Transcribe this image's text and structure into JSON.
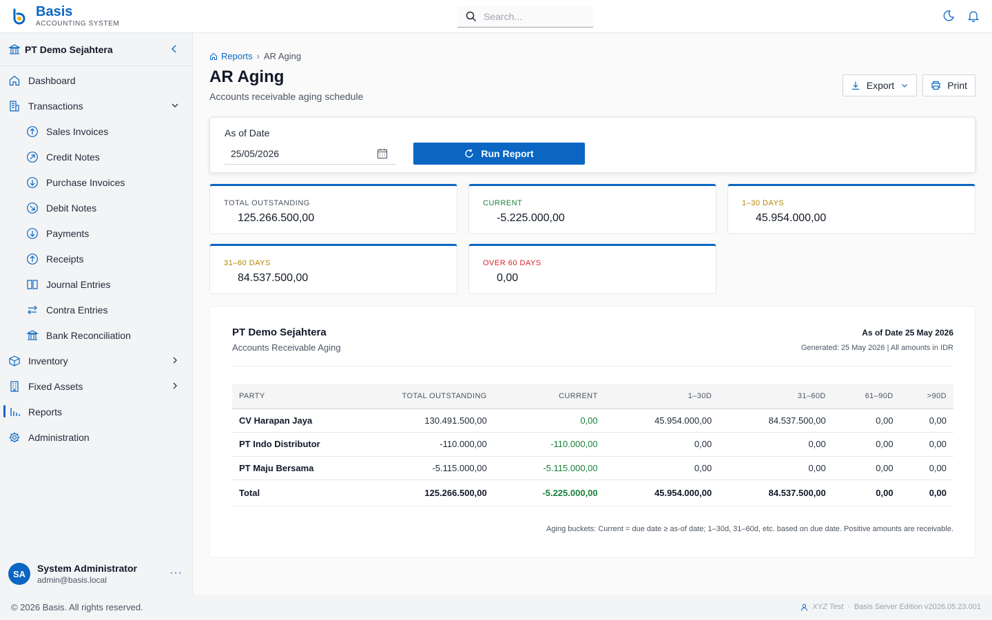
{
  "app": {
    "name": "Basis",
    "subtitle": "ACCOUNTING SYSTEM"
  },
  "search": {
    "placeholder": "Search..."
  },
  "org": {
    "name": "PT Demo Sejahtera"
  },
  "nav": {
    "dashboard": "Dashboard",
    "transactions": "Transactions",
    "sales_invoices": "Sales Invoices",
    "credit_notes": "Credit Notes",
    "purchase_invoices": "Purchase Invoices",
    "debit_notes": "Debit Notes",
    "payments": "Payments",
    "receipts": "Receipts",
    "journal_entries": "Journal Entries",
    "contra_entries": "Contra Entries",
    "bank_reconciliation": "Bank Reconciliation",
    "inventory": "Inventory",
    "fixed_assets": "Fixed Assets",
    "reports": "Reports",
    "administration": "Administration"
  },
  "user": {
    "initials": "SA",
    "name": "System Administrator",
    "email": "admin@basis.local",
    "more": "···"
  },
  "footer": {
    "copyright": "© 2026 Basis. All rights reserved.",
    "tenant": "XYZ Test",
    "dot": "·",
    "version": "Basis Server Edition v2026.05.23.001"
  },
  "breadcrumb": {
    "parent": "Reports",
    "sep": "›",
    "current": "AR Aging"
  },
  "page": {
    "title": "AR Aging",
    "subtitle": "Accounts receivable aging schedule"
  },
  "actions": {
    "export": "Export",
    "print": "Print"
  },
  "filter": {
    "label": "As of Date",
    "date": "25/05/2026",
    "run": "Run Report"
  },
  "stats": [
    {
      "label": "TOTAL OUTSTANDING",
      "value": "125.266.500,00",
      "color": "#4b5563"
    },
    {
      "label": "CURRENT",
      "value": "-5.225.000,00",
      "color": "#198038"
    },
    {
      "label": "1–30 DAYS",
      "value": "45.954.000,00",
      "color": "#b28600"
    },
    {
      "label": "31–60 DAYS",
      "value": "84.537.500,00",
      "color": "#b28600"
    },
    {
      "label": "OVER 60 DAYS",
      "value": "0,00",
      "color": "#da1e28"
    }
  ],
  "report": {
    "company": "PT Demo Sejahtera",
    "title": "Accounts Receivable Aging",
    "as_of": "As of Date 25 May 2026",
    "generated": "Generated: 25 May 2026 | All amounts in IDR",
    "columns": [
      "PARTY",
      "TOTAL OUTSTANDING",
      "CURRENT",
      "1–30D",
      "31–60D",
      "61–90D",
      ">90D"
    ],
    "rows": [
      [
        "CV Harapan Jaya",
        "130.491.500,00",
        "0,00",
        "45.954.000,00",
        "84.537.500,00",
        "0,00",
        "0,00"
      ],
      [
        "PT Indo Distributor",
        "-110.000,00",
        "-110.000,00",
        "0,00",
        "0,00",
        "0,00",
        "0,00"
      ],
      [
        "PT Maju Bersama",
        "-5.115.000,00",
        "-5.115.000,00",
        "0,00",
        "0,00",
        "0,00",
        "0,00"
      ]
    ],
    "total": [
      "Total",
      "125.266.500,00",
      "-5.225.000,00",
      "45.954.000,00",
      "84.537.500,00",
      "0,00",
      "0,00"
    ],
    "note": "Aging buckets: Current = due date ≥ as-of date; 1–30d, 31–60d, etc. based on due date. Positive amounts are receivable."
  },
  "colors": {
    "accent": "#0a66c2",
    "positive": "#198038",
    "warning": "#b28600",
    "danger": "#da1e28"
  }
}
